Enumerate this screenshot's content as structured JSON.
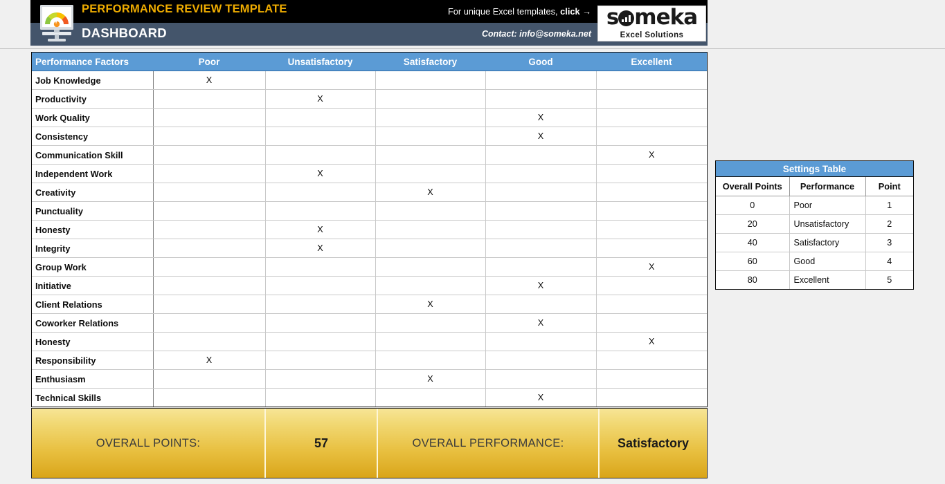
{
  "header": {
    "title": "PERFORMANCE REVIEW TEMPLATE",
    "subtitle": "DASHBOARD",
    "promo_text": "For unique Excel templates, ",
    "promo_cta": "click →",
    "contact": "Contact: info@someka.net",
    "brand_name": "s",
    "brand_name_2": "meka",
    "brand_tagline": "Excel Solutions",
    "logo_icon": "monitor-gauge-icon",
    "colors": {
      "accent_gold": "#f0ad00",
      "navy": "#44556b",
      "black": "#000000"
    }
  },
  "main_table": {
    "columns": [
      "Performance Factors",
      "Poor",
      "Unsatisfactory",
      "Satisfactory",
      "Good",
      "Excellent"
    ],
    "rows": [
      {
        "factor": "Job Knowledge",
        "marks": [
          "X",
          "",
          "",
          "",
          ""
        ]
      },
      {
        "factor": "Productivity",
        "marks": [
          "",
          "X",
          "",
          "",
          ""
        ]
      },
      {
        "factor": "Work Quality",
        "marks": [
          "",
          "",
          "",
          "X",
          ""
        ]
      },
      {
        "factor": "Consistency",
        "marks": [
          "",
          "",
          "",
          "X",
          ""
        ]
      },
      {
        "factor": "Communication Skill",
        "marks": [
          "",
          "",
          "",
          "",
          "X"
        ]
      },
      {
        "factor": "Independent Work",
        "marks": [
          "",
          "X",
          "",
          "",
          ""
        ]
      },
      {
        "factor": "Creativity",
        "marks": [
          "",
          "",
          "X",
          "",
          ""
        ]
      },
      {
        "factor": "Punctuality",
        "marks": [
          "",
          "",
          "",
          "",
          ""
        ]
      },
      {
        "factor": "Honesty",
        "marks": [
          "",
          "X",
          "",
          "",
          ""
        ]
      },
      {
        "factor": "Integrity",
        "marks": [
          "",
          "X",
          "",
          "",
          ""
        ]
      },
      {
        "factor": "Group Work",
        "marks": [
          "",
          "",
          "",
          "",
          "X"
        ]
      },
      {
        "factor": "Initiative",
        "marks": [
          "",
          "",
          "",
          "X",
          ""
        ]
      },
      {
        "factor": "Client Relations",
        "marks": [
          "",
          "",
          "X",
          "",
          ""
        ]
      },
      {
        "factor": "Coworker Relations",
        "marks": [
          "",
          "",
          "",
          "X",
          ""
        ]
      },
      {
        "factor": "Honesty",
        "marks": [
          "",
          "",
          "",
          "",
          "X"
        ]
      },
      {
        "factor": "Responsibility",
        "marks": [
          "X",
          "",
          "",
          "",
          ""
        ]
      },
      {
        "factor": "Enthusiasm",
        "marks": [
          "",
          "",
          "X",
          "",
          ""
        ]
      },
      {
        "factor": "Technical Skills",
        "marks": [
          "",
          "",
          "",
          "X",
          ""
        ]
      }
    ]
  },
  "settings_table": {
    "title": "Settings Table",
    "columns": [
      "Overall Points",
      "Performance",
      "Point"
    ],
    "rows": [
      {
        "overall_points": "0",
        "performance": "Poor",
        "point": "1"
      },
      {
        "overall_points": "20",
        "performance": "Unsatisfactory",
        "point": "2"
      },
      {
        "overall_points": "40",
        "performance": "Satisfactory",
        "point": "3"
      },
      {
        "overall_points": "60",
        "performance": "Good",
        "point": "4"
      },
      {
        "overall_points": "80",
        "performance": "Excellent",
        "point": "5"
      }
    ]
  },
  "summary": {
    "points_label": "OVERALL POINTS:",
    "points_value": "57",
    "performance_label": "OVERALL PERFORMANCE:",
    "performance_value": "Satisfactory"
  }
}
